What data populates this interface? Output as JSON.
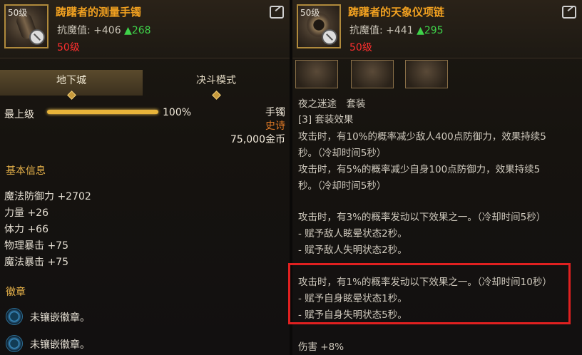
{
  "left": {
    "item_level_badge": "50级",
    "item_name": "踌躇者的测量手镯",
    "resist_label": "抗魔值: +406",
    "resist_increase": "▲268",
    "required_level": "50级",
    "tabs": [
      "地下城",
      "决斗模式"
    ],
    "grade_label": "最上级",
    "grade_fill": 1.0,
    "grade_pct": "100%",
    "item_type": "手镯",
    "rarity": "史诗",
    "price": "75,000金币",
    "basic_info_title": "基本信息",
    "stats": [
      "魔法防御力 +2702",
      "力量 +26",
      "体力 +66",
      "物理暴击 +75",
      "魔法暴击 +75"
    ],
    "emblem_title": "徽章",
    "emblem_slots": [
      "未镶嵌徽章。",
      "未镶嵌徽章。"
    ]
  },
  "right": {
    "item_level_badge": "50级",
    "item_name": "踌躇者的天象仪项链",
    "resist_label": "抗魔值: +441",
    "resist_increase": "▲295",
    "required_level": "50级",
    "set_name": "夜之迷途　套装",
    "set_effect_title": "[3] 套装效果",
    "lines": [
      "攻击时，有10%的概率减少敌人400点防御力，效果持续5",
      "秒。（冷却时间5秒）",
      "攻击时，有5%的概率减少自身100点防御力，效果持续5",
      "秒。（冷却时间5秒）",
      "攻击时，有3%的概率发动以下效果之一。（冷却时间5秒）",
      "- 赋予敌人眩晕状态2秒。",
      "- 赋予敌人失明状态2秒。",
      "攻击时，有1%的概率发动以下效果之一。（冷却时间10秒）",
      "- 赋予自身眩晕状态1秒。",
      "- 赋予自身失明状态5秒。",
      "伤害 +8%"
    ]
  },
  "colors": {
    "item_name": "#f0a020",
    "increase": "#3fd24a",
    "required_level": "#ff2f2f",
    "section_title": "#e7b24a",
    "rarity": "#e07a26",
    "highlight_border": "#e02020"
  }
}
